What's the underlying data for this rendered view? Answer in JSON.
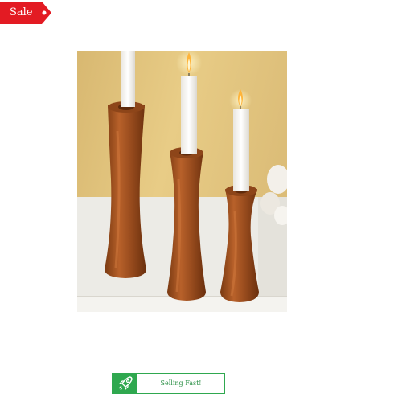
{
  "badges": {
    "sale_label": "Sale",
    "selling_label": "Selling Fast!",
    "sale_color": "#e31b23",
    "selling_color": "#2fa84f"
  },
  "product": {
    "image_icon": "candle-holders-photo"
  },
  "icons": {
    "selling": "rocket-icon"
  }
}
